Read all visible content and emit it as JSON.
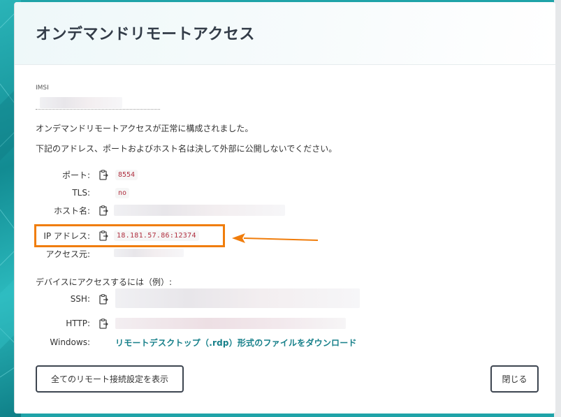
{
  "modal": {
    "title": "オンデマンドリモートアクセス"
  },
  "imsi": {
    "label": "IMSI"
  },
  "messages": {
    "success": "オンデマンドリモートアクセスが正常に構成されました。",
    "warning": "下記のアドレス、ポートおよびホスト名は決して外部に公開しないでください。"
  },
  "details": {
    "port_label": "ポート:",
    "port_value": "8554",
    "tls_label": "TLS:",
    "tls_value": "no",
    "host_label": "ホスト名:",
    "ip_label": "IP アドレス:",
    "ip_value": "18.181.57.86:12374",
    "access_from_label": "アクセス元:"
  },
  "examples": {
    "heading": "デバイスにアクセスするには（例）:",
    "ssh_label": "SSH:",
    "http_label": "HTTP:",
    "windows_label": "Windows:",
    "rdp_link": "リモートデスクトップ（.rdp）形式のファイルをダウンロード"
  },
  "buttons": {
    "show_all": "全てのリモート接続設定を表示",
    "close": "閉じる"
  },
  "colors": {
    "accent": "#17808a",
    "highlight": "#f07d0c",
    "code_text": "#b03040",
    "background_teal": "#1fa3a8"
  },
  "icons": {
    "copy": "clipboard-copy-icon",
    "annotation": "arrow-left-icon"
  }
}
